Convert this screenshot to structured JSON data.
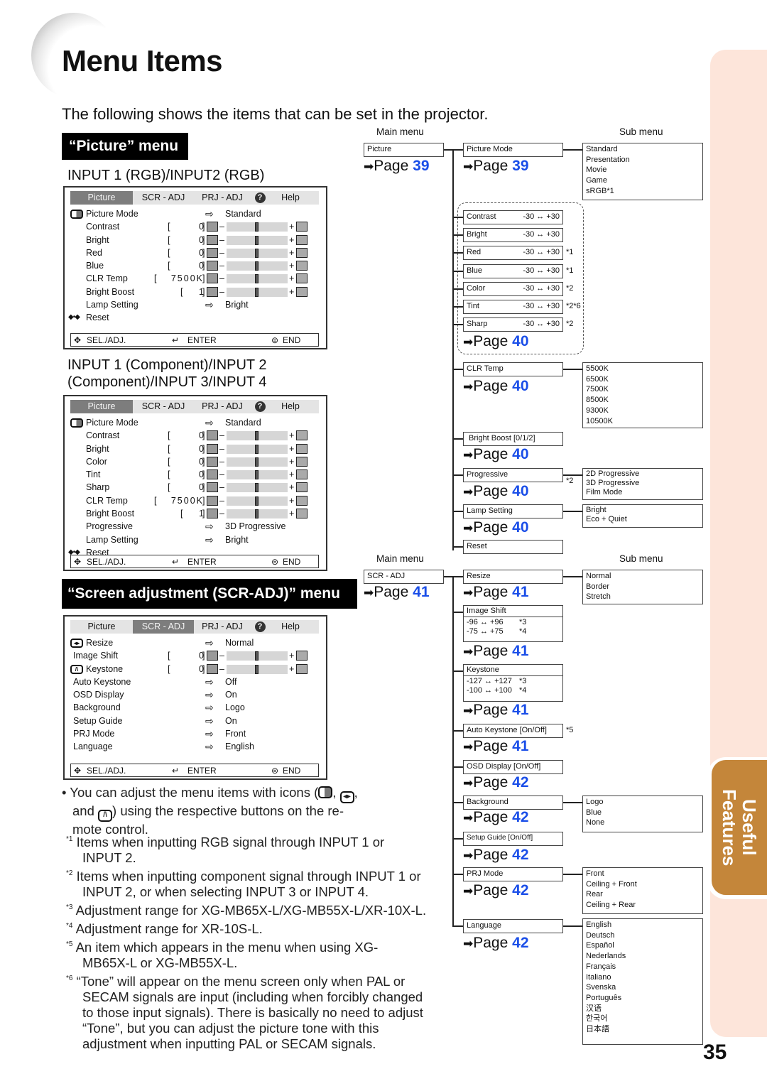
{
  "page": {
    "title": "Menu Items",
    "intro": "The following shows the items that can be set in the projector.",
    "side_tab": "Useful Features",
    "page_number": "35"
  },
  "picture_section": {
    "header": "“Picture” menu",
    "rgb_heading": "INPUT 1 (RGB)/INPUT2 (RGB)",
    "component_heading_line1": "INPUT 1 (Component)/INPUT 2",
    "component_heading_line2": "(Component)/INPUT 3/INPUT 4"
  },
  "scr_section": {
    "header": "“Screen adjustment (SCR-ADJ)” menu"
  },
  "osd": {
    "tabs": [
      "Picture",
      "SCR - ADJ",
      "PRJ - ADJ",
      "?",
      "Help"
    ],
    "footer": {
      "sel": "SEL./ADJ.",
      "enter": "ENTER",
      "end": "END"
    },
    "rgb_rows": [
      {
        "label": "Picture Mode",
        "option": "Standard"
      },
      {
        "label": "Contrast",
        "value": "0"
      },
      {
        "label": "Bright",
        "value": "0"
      },
      {
        "label": "Red",
        "value": "0"
      },
      {
        "label": "Blue",
        "value": "0"
      },
      {
        "label": "CLR Temp",
        "value": "7500K"
      },
      {
        "label": "Bright Boost",
        "value": "1"
      },
      {
        "label": "Lamp Setting",
        "option": "Bright"
      },
      {
        "label": "Reset"
      }
    ],
    "comp_rows": [
      {
        "label": "Picture Mode",
        "option": "Standard"
      },
      {
        "label": "Contrast",
        "value": "0"
      },
      {
        "label": "Bright",
        "value": "0"
      },
      {
        "label": "Color",
        "value": "0"
      },
      {
        "label": "Tint",
        "value": "0"
      },
      {
        "label": "Sharp",
        "value": "0"
      },
      {
        "label": "CLR Temp",
        "value": "7500K"
      },
      {
        "label": "Bright Boost",
        "value": "1"
      },
      {
        "label": "Progressive",
        "option": "3D Progressive"
      },
      {
        "label": "Lamp Setting",
        "option": "Bright"
      },
      {
        "label": "Reset"
      }
    ],
    "scr_rows": [
      {
        "label": "Resize",
        "option": "Normal"
      },
      {
        "label": "Image Shift",
        "value": "0"
      },
      {
        "label": "Keystone",
        "value": "0"
      },
      {
        "label": "Auto Keystone",
        "option": "Off"
      },
      {
        "label": "OSD Display",
        "option": "On"
      },
      {
        "label": "Background",
        "option": "Logo"
      },
      {
        "label": "Setup Guide",
        "option": "On"
      },
      {
        "label": "PRJ Mode",
        "option": "Front"
      },
      {
        "label": "Language",
        "option": "English"
      }
    ]
  },
  "tree": {
    "main_menu_label": "Main menu",
    "sub_menu_label": "Sub menu",
    "page_word": "Page",
    "picture": {
      "main": "Picture",
      "main_page": "39",
      "picture_mode": "Picture Mode",
      "picture_mode_page": "39",
      "picture_mode_options": [
        "Standard",
        "Presentation",
        "Movie",
        "Game",
        "sRGB*1"
      ],
      "adjust_items": [
        {
          "label": "Contrast",
          "range": "-30 ↔ +30",
          "note": ""
        },
        {
          "label": "Bright",
          "range": "-30 ↔ +30",
          "note": ""
        },
        {
          "label": "Red",
          "range": "-30 ↔ +30",
          "note": "*1"
        },
        {
          "label": "Blue",
          "range": "-30 ↔ +30",
          "note": "*1"
        },
        {
          "label": "Color",
          "range": "-30 ↔ +30",
          "note": "*2"
        },
        {
          "label": "Tint",
          "range": "-30 ↔ +30",
          "note": "*2*6"
        },
        {
          "label": "Sharp",
          "range": "-30 ↔ +30",
          "note": "*2"
        }
      ],
      "adjust_page": "40",
      "clr_temp": "CLR Temp",
      "clr_temp_page": "40",
      "clr_temp_options": [
        "5500K",
        "6500K",
        "7500K",
        "8500K",
        "9300K",
        "10500K"
      ],
      "bright_boost": "Bright Boost [0/1/2]",
      "bright_boost_page": "40",
      "progressive": "Progressive",
      "progressive_note": "*2",
      "progressive_page": "40",
      "progressive_options": [
        "2D Progressive",
        "3D Progressive",
        "Film Mode"
      ],
      "lamp_setting": "Lamp Setting",
      "lamp_setting_page": "40",
      "lamp_setting_options": [
        "Bright",
        "Eco + Quiet"
      ],
      "reset": "Reset"
    },
    "scr": {
      "main": "SCR - ADJ",
      "main_page": "41",
      "resize": "Resize",
      "resize_page": "41",
      "resize_options": [
        "Normal",
        "Border",
        "Stretch"
      ],
      "image_shift": "Image Shift",
      "image_shift_ranges": [
        {
          "range": "-96 ↔ +96",
          "note": "*3"
        },
        {
          "range": "-75 ↔ +75",
          "note": "*4"
        }
      ],
      "image_shift_page": "41",
      "keystone": "Keystone",
      "keystone_ranges": [
        {
          "range": "-127 ↔ +127",
          "note": "*3"
        },
        {
          "range": "-100 ↔ +100",
          "note": "*4"
        }
      ],
      "keystone_page": "41",
      "auto_keystone": "Auto Keystone [On/Off]",
      "auto_keystone_note": "*5",
      "auto_keystone_page": "41",
      "osd_display": "OSD Display [On/Off]",
      "osd_display_page": "42",
      "background": "Background",
      "background_page": "42",
      "background_options": [
        "Logo",
        "Blue",
        "None"
      ],
      "setup_guide": "Setup Guide [On/Off]",
      "setup_guide_page": "42",
      "prj_mode": "PRJ Mode",
      "prj_mode_page": "42",
      "prj_mode_options": [
        "Front",
        "Ceiling + Front",
        "Rear",
        "Ceiling + Rear"
      ],
      "language": "Language",
      "language_page": "42",
      "language_options": [
        "English",
        "Deutsch",
        "Español",
        "Nederlands",
        "Français",
        "Italiano",
        "Svenska",
        "Português",
        "汉语",
        "한국어",
        "日本語"
      ]
    }
  },
  "notes": {
    "bullet_a": "You can adjust the menu items with icons (",
    "bullet_b": ",",
    "bullet_c": ",",
    "bullet_d": "and",
    "bullet_e": ") using the respective buttons on the re-",
    "bullet_f": "mote control.",
    "footnotes": [
      {
        "mark": "1",
        "lines": [
          "Items when inputting RGB signal through INPUT 1 or",
          "INPUT 2."
        ]
      },
      {
        "mark": "2",
        "lines": [
          "Items when inputting component signal through INPUT 1 or",
          "INPUT 2, or when selecting INPUT 3 or INPUT 4."
        ]
      },
      {
        "mark": "3",
        "lines": [
          "Adjustment range for XG-MB65X-L/XG-MB55X-L/XR-10X-L."
        ]
      },
      {
        "mark": "4",
        "lines": [
          "Adjustment range for XR-10S-L."
        ]
      },
      {
        "mark": "5",
        "lines": [
          "An item which appears in the menu when using XG-",
          "MB65X-L or XG-MB55X-L."
        ]
      },
      {
        "mark": "6",
        "lines": [
          "“Tone” will appear on the menu screen only when PAL or",
          "SECAM signals are input (including when forcibly changed",
          "to those input signals). There is basically no need to adjust",
          "“Tone”, but you can adjust the picture tone with this",
          "adjustment when inputting PAL or SECAM signals."
        ]
      }
    ]
  }
}
